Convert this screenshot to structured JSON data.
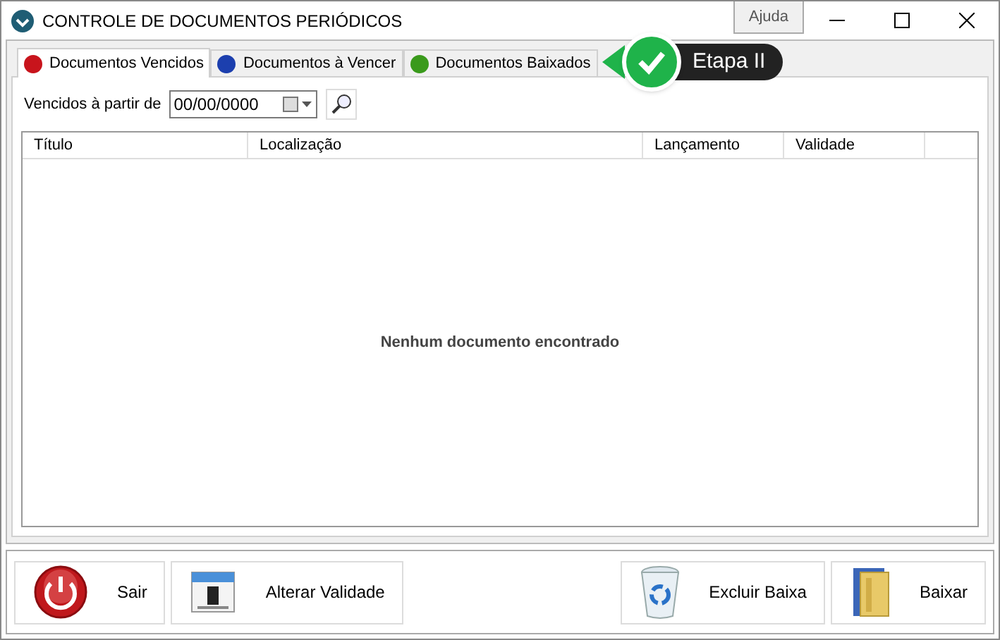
{
  "window": {
    "title": "CONTROLE DE DOCUMENTOS PERIÓDICOS",
    "help_button": "Ajuda"
  },
  "tabs": [
    {
      "label": "Documentos Vencidos",
      "selected": true,
      "color": "#c8141c"
    },
    {
      "label": "Documentos à Vencer",
      "selected": false,
      "color": "#1c3fae"
    },
    {
      "label": "Documentos Baixados",
      "selected": false,
      "color": "#3a9a1c"
    }
  ],
  "callout": {
    "label": "Etapa II"
  },
  "filter": {
    "label": "Vencidos à partir de",
    "date_value": "00/00/0000"
  },
  "table": {
    "columns": [
      "Título",
      "Localização",
      "Lançamento",
      "Validade"
    ],
    "empty_message": "Nenhum documento encontrado"
  },
  "buttons_left": [
    {
      "label": "Sair",
      "kind": "power"
    },
    {
      "label": "Alterar Validade",
      "kind": "calendar"
    }
  ],
  "buttons_right": [
    {
      "label": "Excluir Baixa",
      "kind": "recycle"
    },
    {
      "label": "Baixar",
      "kind": "folder"
    }
  ]
}
